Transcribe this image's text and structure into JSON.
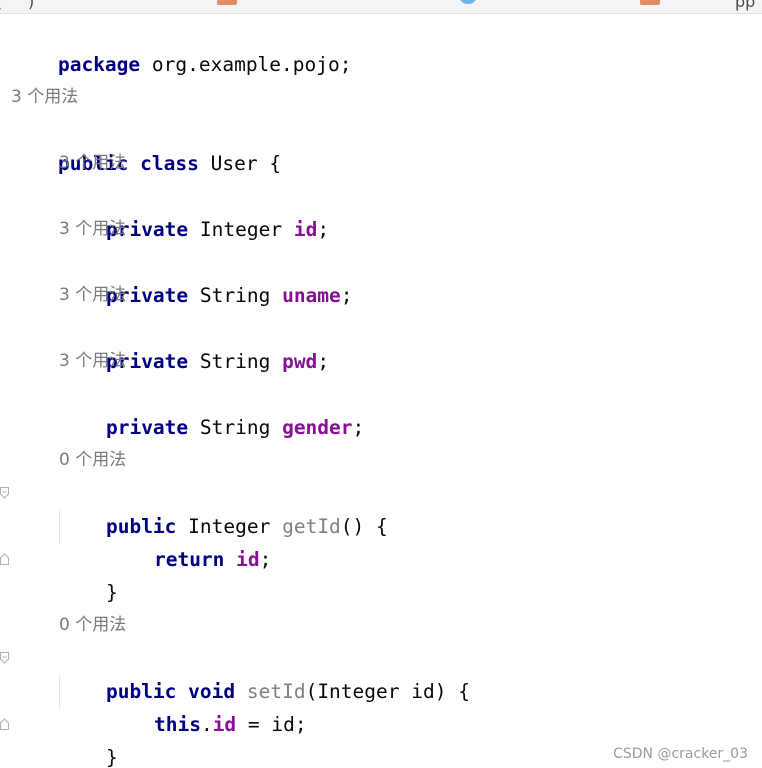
{
  "tab_strip": {
    "fragments": [
      "(",
      ")",
      "",
      "",
      "",
      "",
      "pp"
    ]
  },
  "editor": {
    "lines": {
      "package_kw": "package",
      "package_name": " org.example.pojo;",
      "hint_class": "3 个用法",
      "public_kw": "public",
      "class_kw": " class",
      "class_name": " User {",
      "hint_id": "3 个用法",
      "private_id_kw": "private",
      "id_type": " Integer ",
      "id_name": "id",
      "id_semi": ";",
      "hint_uname": "3 个用法",
      "private_uname_kw": "private",
      "uname_type": " String ",
      "uname_name": "uname",
      "uname_semi": ";",
      "hint_pwd": "3 个用法",
      "private_pwd_kw": "private",
      "pwd_type": " String ",
      "pwd_name": "pwd",
      "pwd_semi": ";",
      "hint_gender": "3 个用法",
      "private_gender_kw": "private",
      "gender_type": " String ",
      "gender_name": "gender",
      "gender_semi": ";",
      "hint_getid": "0 个用法",
      "getid_public_kw": "public",
      "getid_type": " Integer ",
      "getid_name": "getId",
      "getid_rest": "() {",
      "return_kw": "return",
      "return_space": " ",
      "return_field": "id",
      "return_semi": ";",
      "getid_close": "}",
      "hint_setid": "0 个用法",
      "setid_public_kw": "public",
      "setid_void_kw": " void",
      "setid_space": " ",
      "setid_name": "setId",
      "setid_params": "(Integer id) {",
      "this_kw": "this",
      "this_dot": ".",
      "this_field": "id",
      "this_assign": " = id;",
      "setid_close": "}"
    }
  },
  "watermark": "CSDN @cracker_03",
  "colors": {
    "keyword": "#000080",
    "field": "#871094",
    "unused_method": "#808080",
    "plain": "#080808",
    "hint": "#7a7a7a"
  }
}
